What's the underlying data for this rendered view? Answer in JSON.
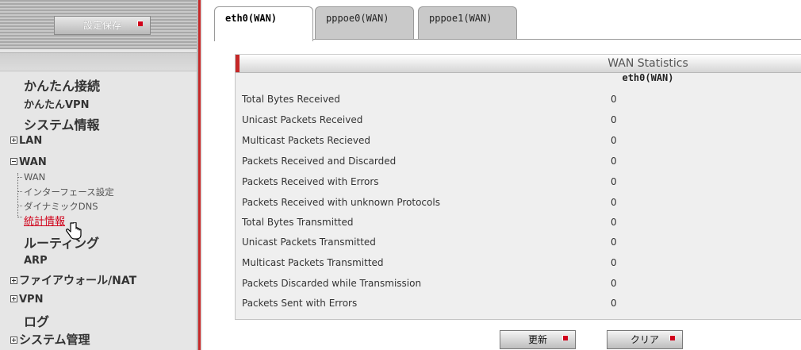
{
  "sidebar": {
    "save_button_label": "設定保存",
    "menu": {
      "easy_connect": "かんたん接続",
      "easy_vpn": "かんたんVPN",
      "system_info": "システム情報",
      "lan": "LAN",
      "wan": "WAN",
      "wan_sub": {
        "wan": "WAN",
        "interface_settings": "インターフェース設定",
        "dynamic_dns": "ダイナミックDNS",
        "statistics": "統計情報"
      },
      "routing": "ルーティング",
      "arp": "ARP",
      "firewall_nat": "ファイアウォール/NAT",
      "vpn": "VPN",
      "log": "ログ",
      "system_admin": "システム管理"
    }
  },
  "tabs": [
    {
      "label": "eth0(WAN)",
      "active": true
    },
    {
      "label": "pppoe0(WAN)",
      "active": false
    },
    {
      "label": "pppoe1(WAN)",
      "active": false
    }
  ],
  "stats": {
    "title": "WAN Statistics",
    "subtitle": "eth0(WAN)",
    "rows": [
      {
        "label": "Total Bytes Received",
        "value": "0"
      },
      {
        "label": "Unicast Packets Received",
        "value": "0"
      },
      {
        "label": "Multicast Packets Recieved",
        "value": "0"
      },
      {
        "label": "Packets Received and Discarded",
        "value": "0"
      },
      {
        "label": "Packets Received with Errors",
        "value": "0"
      },
      {
        "label": "Packets Received with unknown Protocols",
        "value": "0"
      },
      {
        "label": "Total Bytes Transmitted",
        "value": "0"
      },
      {
        "label": "Unicast Packets Transmitted",
        "value": "0"
      },
      {
        "label": "Multicast Packets Transmitted",
        "value": "0"
      },
      {
        "label": "Packets Discarded while Transmission",
        "value": "0"
      },
      {
        "label": "Packets Sent with Errors",
        "value": "0"
      }
    ]
  },
  "buttons": {
    "refresh": "更新",
    "clear": "クリア"
  },
  "colors": {
    "accent_red": "#c62828",
    "active_link": "#d0021b",
    "sidebar_bg": "#e6e6e6",
    "panel_bg": "#efefef"
  }
}
